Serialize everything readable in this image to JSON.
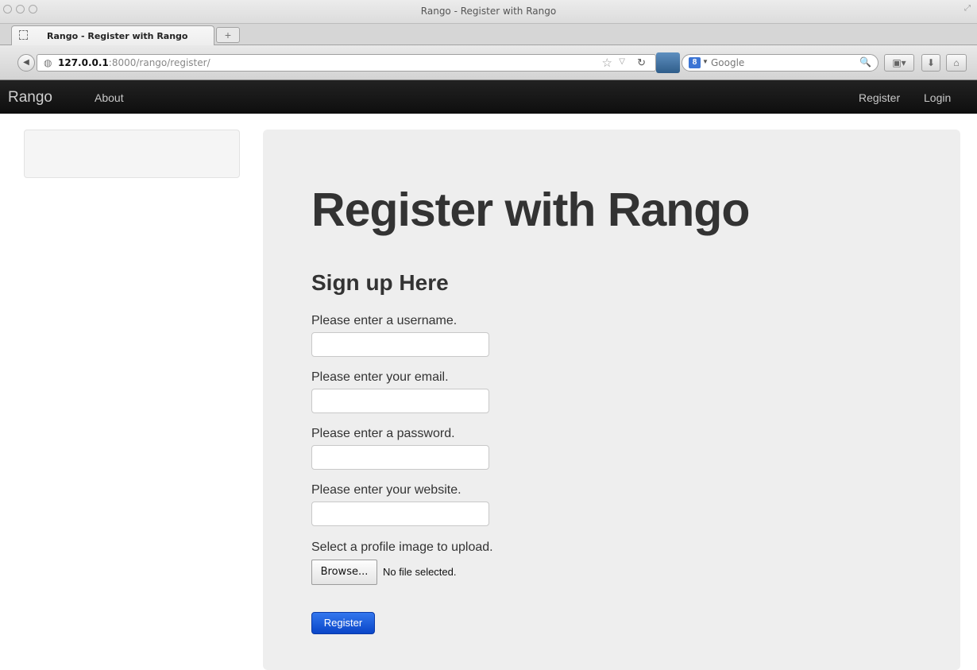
{
  "window": {
    "title": "Rango - Register with Rango"
  },
  "tabs": [
    {
      "label": "Rango - Register with Rango"
    }
  ],
  "newtab": {
    "label": "+"
  },
  "address": {
    "host": "127.0.0.1",
    "rest": ":8000/rango/register/"
  },
  "search": {
    "engine_badge": "8",
    "engine_name": "Google"
  },
  "site_nav": {
    "brand": "Rango",
    "about": "About",
    "register": "Register",
    "login": "Login"
  },
  "page": {
    "title": "Register with Rango",
    "subtitle": "Sign up Here",
    "fields": [
      {
        "label": "Please enter a username.",
        "value": ""
      },
      {
        "label": "Please enter your email.",
        "value": ""
      },
      {
        "label": "Please enter a password.",
        "value": ""
      },
      {
        "label": "Please enter your website.",
        "value": ""
      }
    ],
    "picture_label": "Select a profile image to upload.",
    "browse_label": "Browse...",
    "no_file": "No file selected.",
    "submit_label": "Register"
  },
  "colors": {
    "navbar_bg": "#111111",
    "panel_bg": "#eeeeee",
    "submit_bg": "#1a56d6",
    "heading": "#333333"
  }
}
